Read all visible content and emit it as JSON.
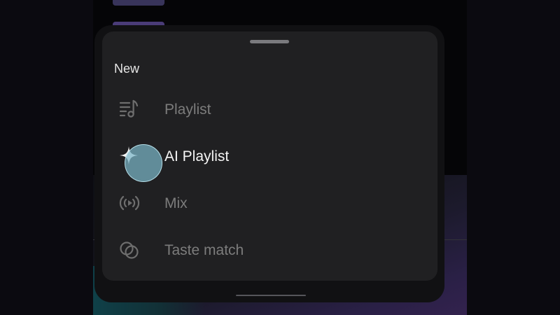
{
  "sheet": {
    "section_title": "New",
    "items": [
      {
        "label": "Playlist",
        "icon": "playlist-music-icon",
        "active": false
      },
      {
        "label": "AI Playlist",
        "icon": "sparkle-icon",
        "active": true
      },
      {
        "label": "Mix",
        "icon": "radio-broadcast-icon",
        "active": false
      },
      {
        "label": "Taste match",
        "icon": "taste-match-icon",
        "active": false
      }
    ]
  },
  "colors": {
    "sheet_background": "#202022",
    "active_text": "#f4f4f4",
    "inactive_text": "#7c7c7c",
    "touch_indicator": "#7ab6c8"
  }
}
